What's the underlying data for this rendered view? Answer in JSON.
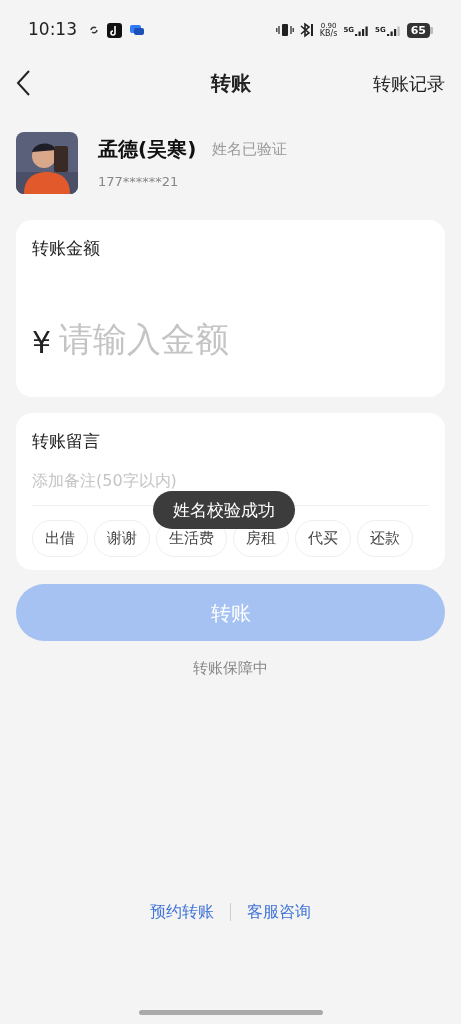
{
  "status_bar": {
    "time": "10:13",
    "network_speed": "0.90",
    "network_unit": "KB/s",
    "sim_1": "5G",
    "sim_2": "5G",
    "battery": "65"
  },
  "header": {
    "title": "转账",
    "action": "转账记录"
  },
  "payee": {
    "name": "孟德(吴寒)",
    "verified": "姓名已验证",
    "phone": "177******21"
  },
  "amount_card": {
    "label": "转账金额",
    "currency": "¥",
    "placeholder": "请输入金额"
  },
  "remark_card": {
    "label": "转账留言",
    "placeholder": "添加备注(50字以内)",
    "tags": [
      "出借",
      "谢谢",
      "生活费",
      "房租",
      "代买",
      "还款"
    ]
  },
  "submit": {
    "label": "转账",
    "disabled": true
  },
  "guarantee": "转账保障中",
  "footer_links": [
    "预约转账",
    "客服咨询"
  ],
  "toast": "姓名校验成功"
}
